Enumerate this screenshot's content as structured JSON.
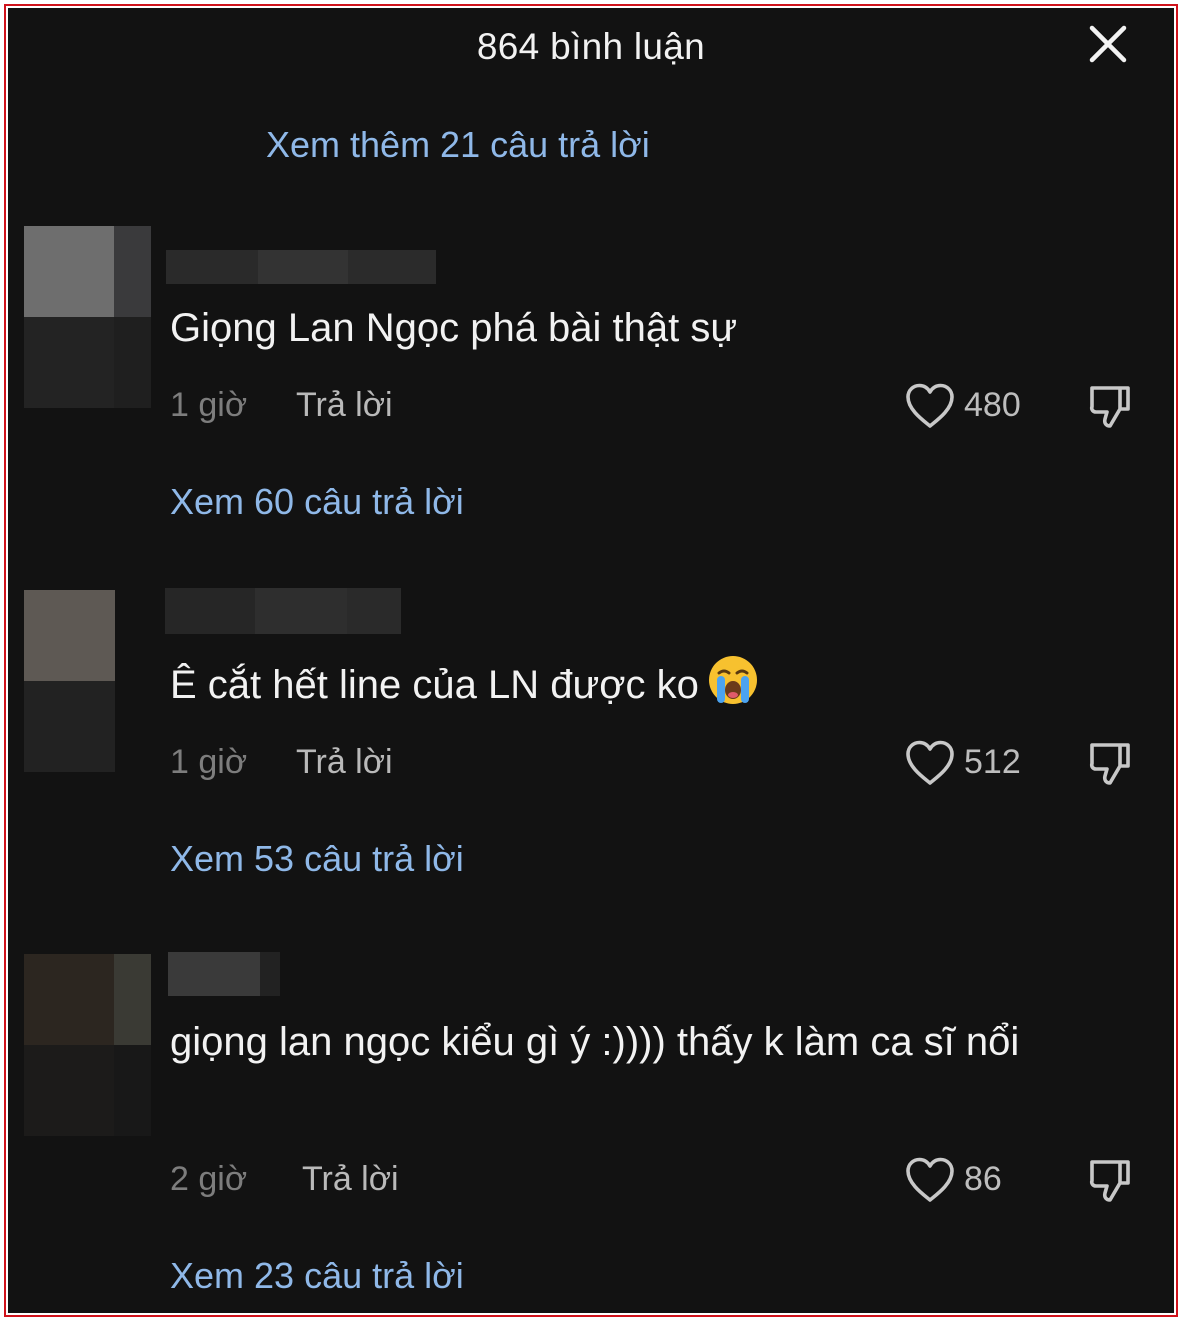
{
  "header": {
    "title": "864 bình luận"
  },
  "top_more_replies": "Xem thêm 21 câu trả lời",
  "icons": {
    "close": "close-icon",
    "like": "heart-outline-icon",
    "dislike": "thumbs-down-icon",
    "emoji": "loudly-crying-face-emoji"
  },
  "colors": {
    "background": "#121212",
    "link": "#8fb8e8",
    "text": "#f2f2f2",
    "muted": "#7d7d7d",
    "frame": "#d0121b"
  },
  "comments": [
    {
      "text": "Giọng Lan Ngọc phá bài thật sự",
      "time": "1 giờ",
      "reply_label": "Trả lời",
      "likes": "480",
      "view_replies": "Xem 60 câu trả lời"
    },
    {
      "text": "Ê cắt hết line của LN được ko",
      "emoji": "😭",
      "time": "1 giờ",
      "reply_label": "Trả lời",
      "likes": "512",
      "view_replies": "Xem 53 câu trả lời"
    },
    {
      "text": "giọng lan ngọc kiểu gì ý :)))) thấy k làm ca sĩ nổi",
      "time": "2 giờ",
      "reply_label": "Trả lời",
      "likes": "86",
      "view_replies": "Xem 23 câu trả lời"
    }
  ]
}
